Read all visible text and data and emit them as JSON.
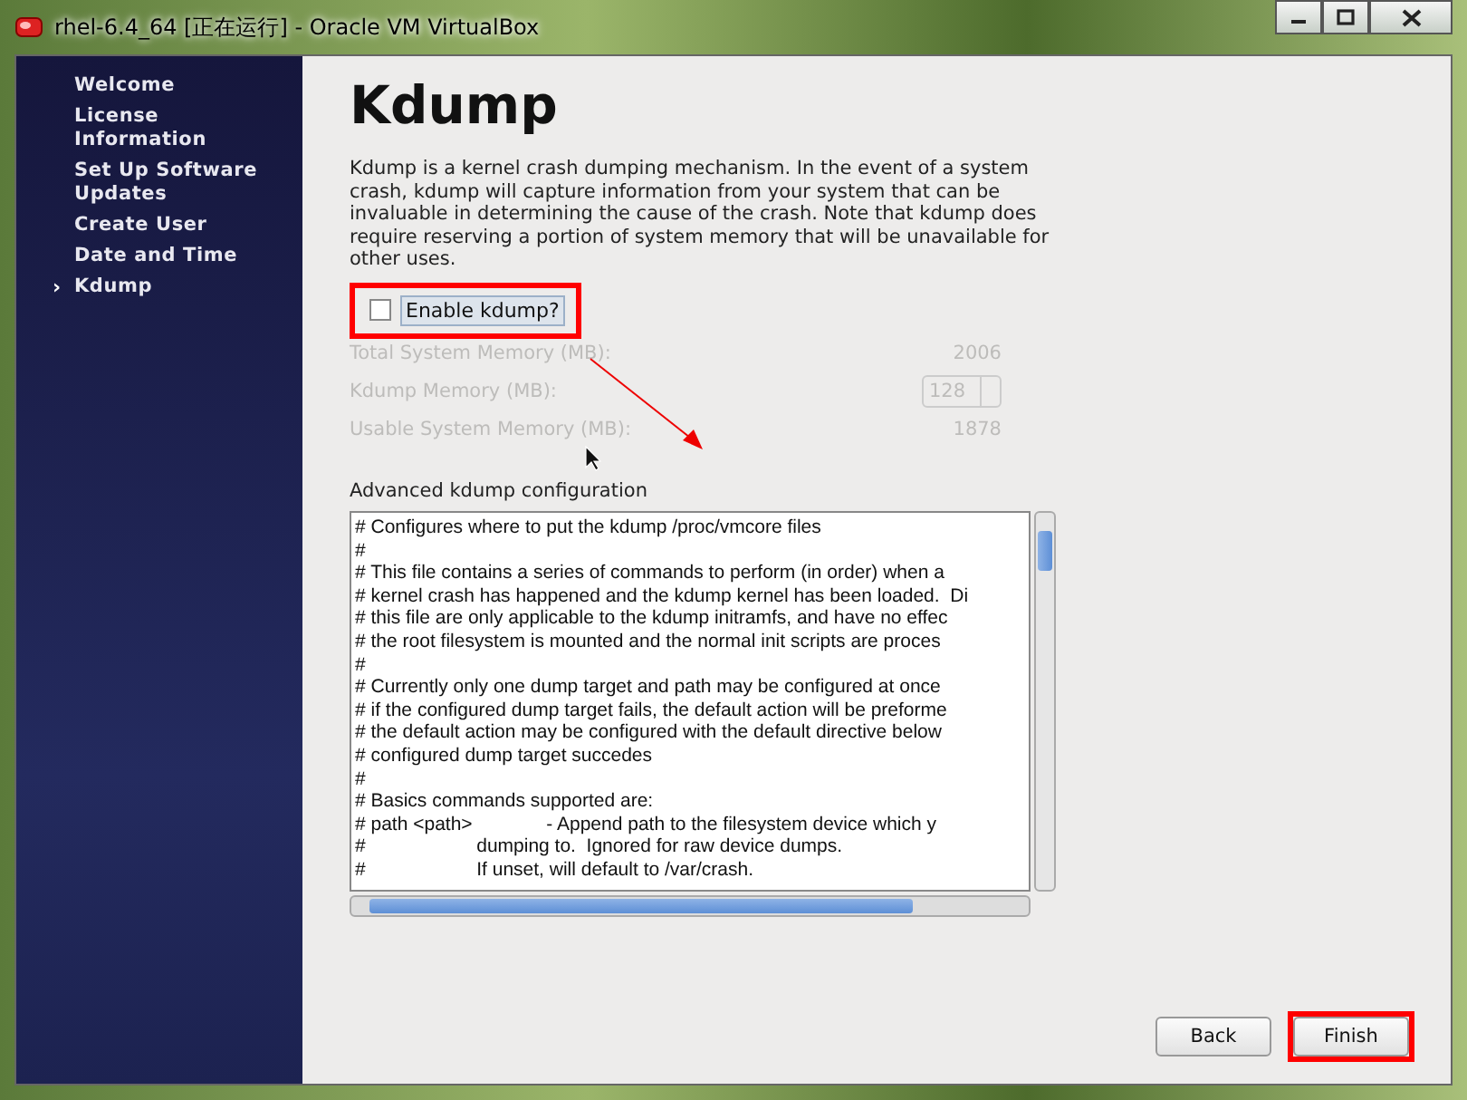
{
  "window": {
    "title": "rhel-6.4_64 [正在运行] - Oracle VM VirtualBox"
  },
  "sidebar": {
    "items": [
      {
        "label": "Welcome",
        "selected": false
      },
      {
        "label": "License Information",
        "selected": false
      },
      {
        "label": "Set Up Software Updates",
        "selected": false
      },
      {
        "label": "Create User",
        "selected": false
      },
      {
        "label": "Date and Time",
        "selected": false
      },
      {
        "label": "Kdump",
        "selected": true
      }
    ],
    "current_marker": "›"
  },
  "page": {
    "title": "Kdump",
    "description": "Kdump is a kernel crash dumping mechanism. In the event of a system crash, kdump will capture information from your system that can be invaluable in determining the cause of the crash. Note that kdump does require reserving a portion of system memory that will be unavailable for other uses.",
    "enable": {
      "label": "Enable kdump?",
      "checked": false
    },
    "memory": {
      "disabled": true,
      "total_label": "Total System Memory (MB):",
      "total_value": "2006",
      "kdump_label": "Kdump Memory (MB):",
      "kdump_value": "128",
      "usable_label": "Usable System Memory (MB):",
      "usable_value": "1878"
    },
    "advanced": {
      "label": "Advanced kdump configuration",
      "lines": [
        "# Configures where to put the kdump /proc/vmcore files",
        "#",
        "# This file contains a series of commands to perform (in order) when a",
        "# kernel crash has happened and the kdump kernel has been loaded.  Di",
        "# this file are only applicable to the kdump initramfs, and have no effec",
        "# the root filesystem is mounted and the normal init scripts are proces",
        "#",
        "# Currently only one dump target and path may be configured at once",
        "# if the configured dump target fails, the default action will be preforme",
        "# the default action may be configured with the default directive below",
        "# configured dump target succedes",
        "#",
        "# Basics commands supported are:",
        "# path <path>              - Append path to the filesystem device which y",
        "#                     dumping to.  Ignored for raw device dumps.",
        "#                     If unset, will default to /var/crash."
      ]
    }
  },
  "buttons": [
    {
      "label": "Back",
      "highlighted": false
    },
    {
      "label": "Finish",
      "highlighted": true
    }
  ]
}
